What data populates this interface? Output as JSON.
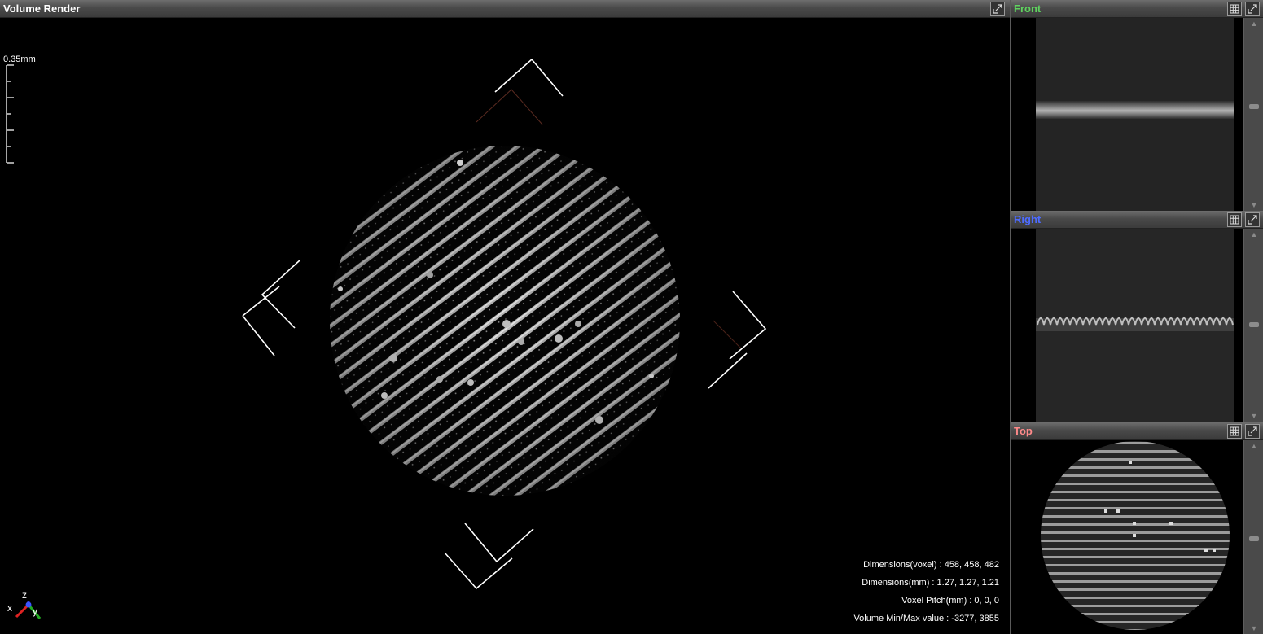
{
  "main_view": {
    "title": "Volume Render",
    "scale_label": "0.35mm",
    "info": {
      "dimensions_voxel": "Dimensions(voxel) : 458, 458, 482",
      "dimensions_mm": "Dimensions(mm) : 1.27, 1.27, 1.21",
      "voxel_pitch": "Voxel Pitch(mm) : 0, 0, 0",
      "min_max": "Volume Min/Max value : -3277, 3855"
    },
    "axis_labels": {
      "x": "x",
      "y": "y",
      "z": "z"
    }
  },
  "panels": {
    "front": {
      "title": "Front",
      "color": "#5fd35f"
    },
    "right": {
      "title": "Right",
      "color": "#4d6bff"
    },
    "top": {
      "title": "Top",
      "color": "#ff8a8a"
    }
  },
  "icons": {
    "maximize": "maximize-icon",
    "grid": "grid-icon"
  }
}
